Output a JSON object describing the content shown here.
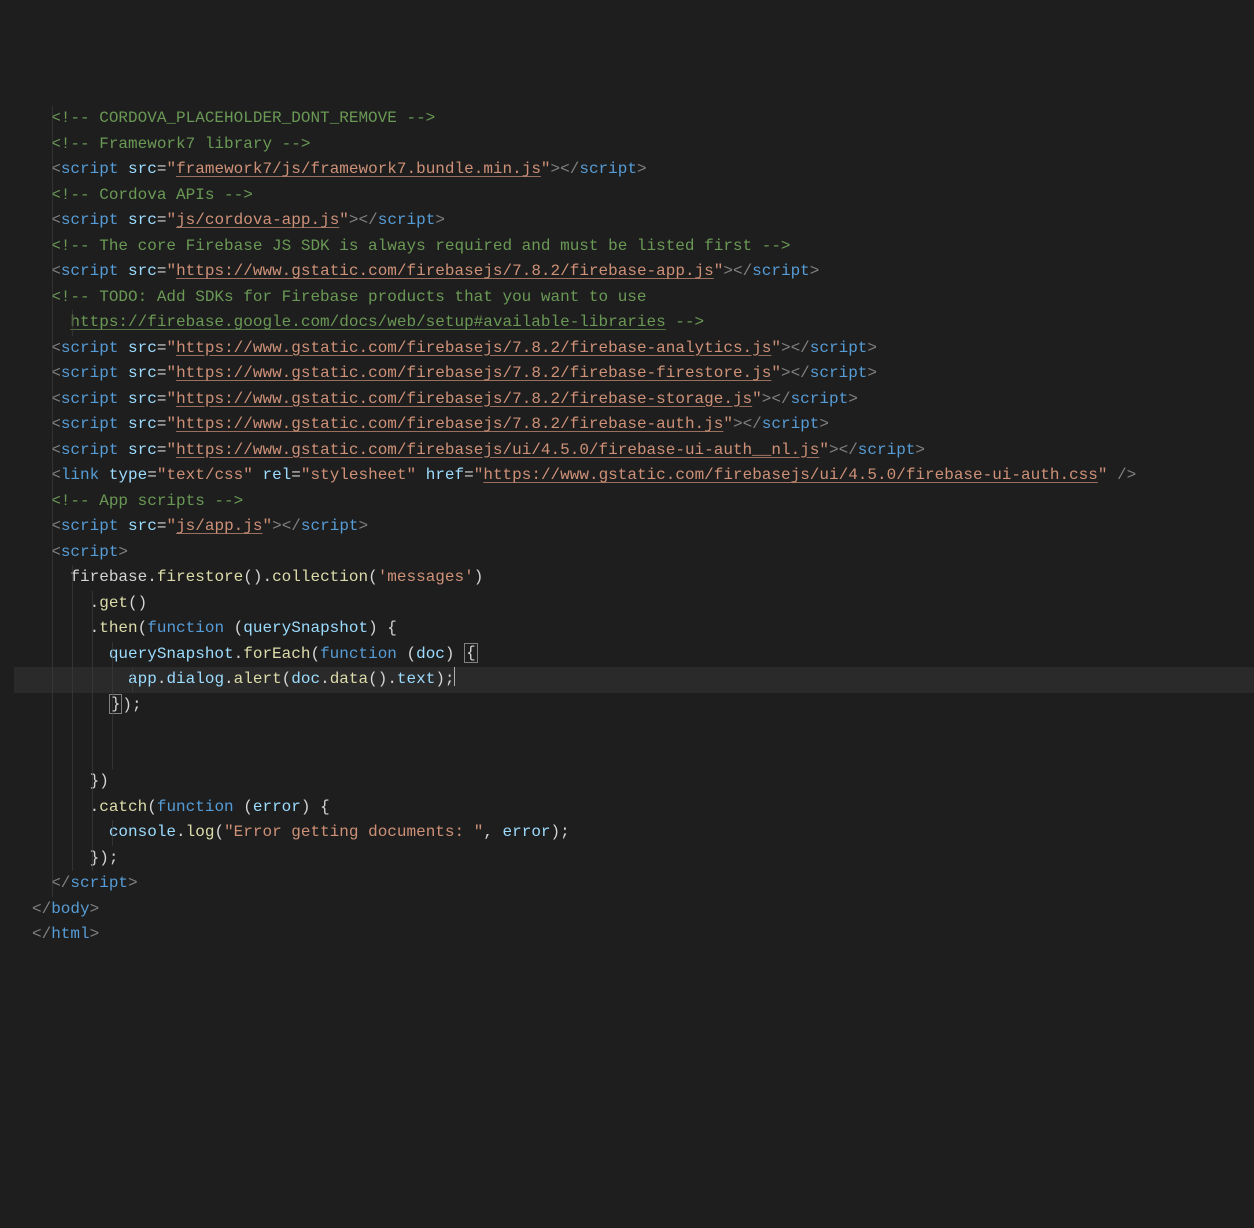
{
  "colors": {
    "background": "#1e1e1e",
    "comment": "#6a9955",
    "tag": "#569cd6",
    "attribute": "#9cdcfe",
    "string": "#ce9178",
    "punctuation": "#808080",
    "function": "#dcdcaa",
    "keyword": "#569cd6",
    "parameter": "#9cdcfe",
    "default": "#d4d4d4",
    "cursorLineBg": "#2a2a2a"
  },
  "lines": [
    {
      "type": "comment",
      "text": "<!-- CORDOVA_PLACEHOLDER_DONT_REMOVE -->",
      "indent": 1
    },
    {
      "type": "comment",
      "text": "<!-- Framework7 library -->",
      "indent": 1
    },
    {
      "type": "script",
      "src": "framework7/js/framework7.bundle.min.js",
      "underline": true,
      "indent": 1
    },
    {
      "type": "comment",
      "text": "<!-- Cordova APIs -->",
      "indent": 1
    },
    {
      "type": "script",
      "src": "js/cordova-app.js",
      "underline": true,
      "indent": 1
    },
    {
      "type": "blank"
    },
    {
      "type": "blank"
    },
    {
      "type": "comment",
      "text": "<!-- The core Firebase JS SDK is always required and must be listed first -->",
      "indent": 1
    },
    {
      "type": "script",
      "src": "https://www.gstatic.com/firebasejs/7.8.2/firebase-app.js",
      "underline": true,
      "indent": 1
    },
    {
      "type": "blank"
    },
    {
      "type": "comment",
      "text": "<!-- TODO: Add SDKs for Firebase products that you want to use",
      "indent": 1
    },
    {
      "type": "comment-link",
      "text": "https://firebase.google.com/docs/web/setup#available-libraries",
      "suffix": " -->",
      "indent": 2
    },
    {
      "type": "script",
      "src": "https://www.gstatic.com/firebasejs/7.8.2/firebase-analytics.js",
      "underline": true,
      "indent": 1
    },
    {
      "type": "script",
      "src": "https://www.gstatic.com/firebasejs/7.8.2/firebase-firestore.js",
      "underline": true,
      "indent": 1
    },
    {
      "type": "script",
      "src": "https://www.gstatic.com/firebasejs/7.8.2/firebase-storage.js",
      "underline": true,
      "indent": 1
    },
    {
      "type": "script",
      "src": "https://www.gstatic.com/firebasejs/7.8.2/firebase-auth.js",
      "underline": true,
      "indent": 1
    },
    {
      "type": "script",
      "src": "https://www.gstatic.com/firebasejs/ui/4.5.0/firebase-ui-auth__nl.js",
      "underline": true,
      "indent": 1
    },
    {
      "type": "link",
      "typeAttr": "text/css",
      "rel": "stylesheet",
      "href": "https://www.gstatic.com/firebasejs/ui/4.5.0/firebase-ui-auth.css",
      "underline": true,
      "indent": 1
    },
    {
      "type": "blank"
    },
    {
      "type": "comment",
      "text": "<!-- App scripts -->",
      "indent": 1
    },
    {
      "type": "script",
      "src": "js/app.js",
      "underline": true,
      "indent": 1
    },
    {
      "type": "open-tag",
      "tag": "script",
      "indent": 1
    },
    {
      "type": "js",
      "indent": 2,
      "tokens": [
        {
          "c": "fg",
          "t": "firebase."
        },
        {
          "c": "fn",
          "t": "firestore"
        },
        {
          "c": "fg",
          "t": "()."
        },
        {
          "c": "fn",
          "t": "collection"
        },
        {
          "c": "fg",
          "t": "("
        },
        {
          "c": "s",
          "t": "'messages'"
        },
        {
          "c": "fg",
          "t": ")"
        }
      ]
    },
    {
      "type": "js",
      "indent": 3,
      "tokens": [
        {
          "c": "fg",
          "t": "."
        },
        {
          "c": "fn",
          "t": "get"
        },
        {
          "c": "fg",
          "t": "()"
        }
      ]
    },
    {
      "type": "js",
      "indent": 3,
      "tokens": [
        {
          "c": "fg",
          "t": "."
        },
        {
          "c": "fn",
          "t": "then"
        },
        {
          "c": "fg",
          "t": "("
        },
        {
          "c": "kw",
          "t": "function"
        },
        {
          "c": "fg",
          "t": " ("
        },
        {
          "c": "pa",
          "t": "querySnapshot"
        },
        {
          "c": "fg",
          "t": ") {"
        }
      ]
    },
    {
      "type": "js",
      "indent": 4,
      "tokens": [
        {
          "c": "pa",
          "t": "querySnapshot"
        },
        {
          "c": "fg",
          "t": "."
        },
        {
          "c": "fn",
          "t": "forEach"
        },
        {
          "c": "fg",
          "t": "("
        },
        {
          "c": "kw",
          "t": "function"
        },
        {
          "c": "fg",
          "t": " ("
        },
        {
          "c": "pa",
          "t": "doc"
        },
        {
          "c": "fg",
          "t": ") "
        },
        {
          "c": "box",
          "t": "{"
        }
      ]
    },
    {
      "type": "js",
      "indent": 5,
      "cursor": true,
      "tokens": [
        {
          "c": "pa",
          "t": "app"
        },
        {
          "c": "fg",
          "t": "."
        },
        {
          "c": "pa",
          "t": "dialog"
        },
        {
          "c": "fg",
          "t": "."
        },
        {
          "c": "fn",
          "t": "alert"
        },
        {
          "c": "fg",
          "t": "("
        },
        {
          "c": "pa",
          "t": "doc"
        },
        {
          "c": "fg",
          "t": "."
        },
        {
          "c": "fn",
          "t": "data"
        },
        {
          "c": "fg",
          "t": "()."
        },
        {
          "c": "pa",
          "t": "text"
        },
        {
          "c": "fg",
          "t": ");"
        },
        {
          "c": "caret",
          "t": ""
        }
      ]
    },
    {
      "type": "js",
      "indent": 4,
      "tokens": [
        {
          "c": "box",
          "t": "}"
        },
        {
          "c": "fg",
          "t": ");"
        }
      ]
    },
    {
      "type": "blank",
      "indent": 4
    },
    {
      "type": "blank",
      "indent": 4
    },
    {
      "type": "js",
      "indent": 3,
      "tokens": [
        {
          "c": "fg",
          "t": "})"
        }
      ]
    },
    {
      "type": "js",
      "indent": 3,
      "tokens": [
        {
          "c": "fg",
          "t": "."
        },
        {
          "c": "fn",
          "t": "catch"
        },
        {
          "c": "fg",
          "t": "("
        },
        {
          "c": "kw",
          "t": "function"
        },
        {
          "c": "fg",
          "t": " ("
        },
        {
          "c": "pa",
          "t": "error"
        },
        {
          "c": "fg",
          "t": ") {"
        }
      ]
    },
    {
      "type": "js",
      "indent": 4,
      "tokens": [
        {
          "c": "pa",
          "t": "console"
        },
        {
          "c": "fg",
          "t": "."
        },
        {
          "c": "fn",
          "t": "log"
        },
        {
          "c": "fg",
          "t": "("
        },
        {
          "c": "s",
          "t": "\"Error getting documents: \""
        },
        {
          "c": "fg",
          "t": ", "
        },
        {
          "c": "pa",
          "t": "error"
        },
        {
          "c": "fg",
          "t": ");"
        }
      ]
    },
    {
      "type": "js",
      "indent": 3,
      "tokens": [
        {
          "c": "fg",
          "t": "});"
        }
      ]
    },
    {
      "type": "close-tag",
      "tag": "script",
      "indent": 1
    },
    {
      "type": "close-tag",
      "tag": "body",
      "indent": 0
    },
    {
      "type": "blank"
    },
    {
      "type": "close-tag",
      "tag": "html",
      "indent": 0
    }
  ]
}
